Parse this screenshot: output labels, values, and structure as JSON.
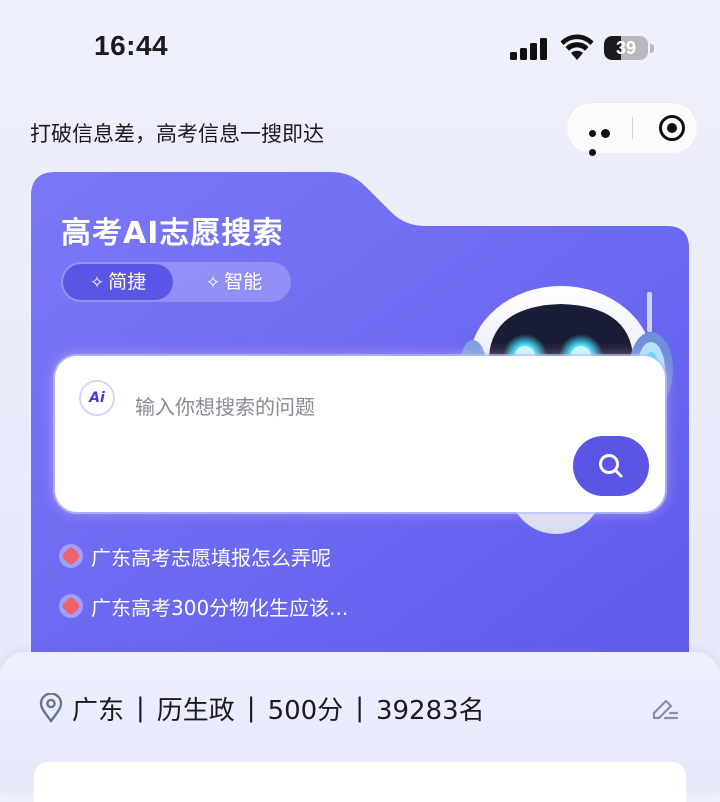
{
  "status_bar": {
    "time": "16:44",
    "battery": "39",
    "battery_level": 0.39
  },
  "header": {
    "tagline": "打破信息差，高考信息一搜即达"
  },
  "capsule": {
    "more_icon": "more-dots-icon",
    "close_icon": "target-close-icon"
  },
  "card": {
    "title": "高考AI志愿搜索",
    "modes": [
      {
        "label": "简捷",
        "selected": true
      },
      {
        "label": "智能",
        "selected": false
      }
    ],
    "spark_glyph": "✧",
    "colors": {
      "accent": "#5b55e6",
      "card_bg": "#6b68f2"
    }
  },
  "search": {
    "ai_badge": "Ai",
    "placeholder": "输入你想搜索的问题",
    "value": ""
  },
  "suggestions": [
    {
      "text": "广东高考志愿填报怎么弄呢"
    },
    {
      "text": "广东高考300分物化生应该..."
    }
  ],
  "profile": {
    "region": "广东",
    "subjects": "历生政",
    "score": "500分",
    "rank": "39283名",
    "separator": "|"
  }
}
